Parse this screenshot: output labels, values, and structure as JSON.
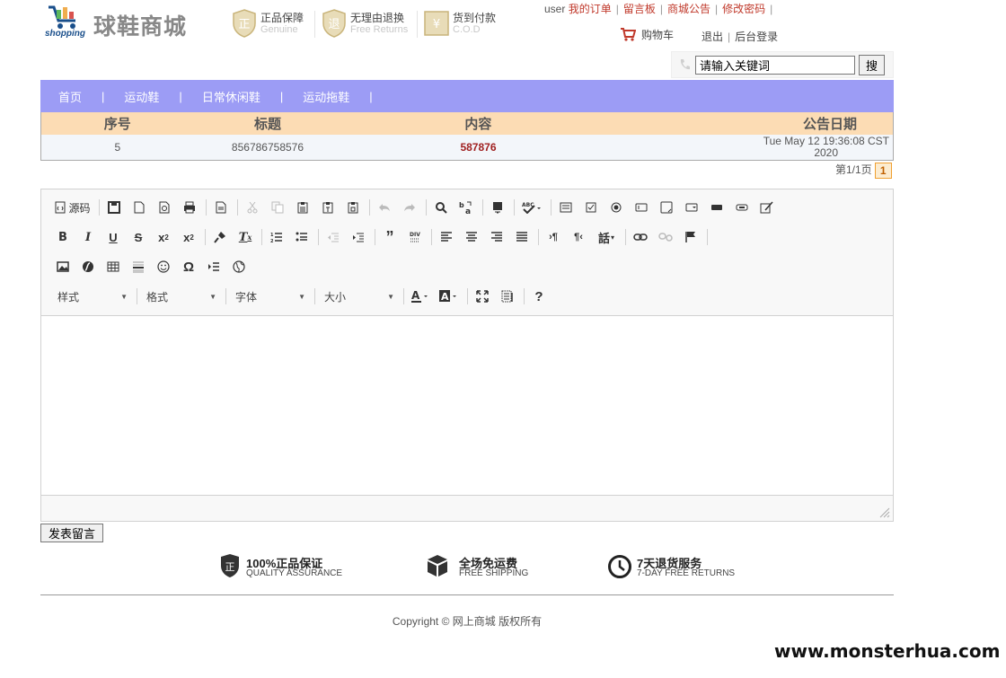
{
  "header": {
    "logo_text": "shopping",
    "site_name": "球鞋商城",
    "badges": [
      {
        "glyph": "正",
        "main": "正品保障",
        "sub": "Genuine"
      },
      {
        "glyph": "退",
        "main": "无理由退换",
        "sub": "Free Returns"
      },
      {
        "glyph": "¥",
        "main": "货到付款",
        "sub": "C.O.D"
      }
    ],
    "user": "user",
    "top_links": [
      "我的订单",
      "留言板",
      "商城公告",
      "修改密码"
    ],
    "cart_label": "购物车",
    "logout_label": "退出",
    "admin_label": "后台登录"
  },
  "search": {
    "value": "请输入关键词",
    "button_label": "搜"
  },
  "nav": {
    "items": [
      "首页",
      "运动鞋",
      "日常休闲鞋",
      "运动拖鞋"
    ]
  },
  "table": {
    "headers": [
      "序号",
      "标题",
      "内容",
      "公告日期"
    ],
    "rows": [
      {
        "id": "5",
        "title": "856786758576",
        "content": "587876",
        "date_line1": "Tue May 12 19:36:08 CST",
        "date_line2": "2020"
      }
    ]
  },
  "pager": {
    "text": "第1/1页",
    "current": "1"
  },
  "editor": {
    "source_label": "源码",
    "combos": [
      "样式",
      "格式",
      "字体",
      "大小"
    ],
    "help_label": "?"
  },
  "post_button_label": "发表留言",
  "footer": {
    "features": [
      {
        "icon": "shield-icon",
        "main": "100%正品保证",
        "sub": "QUALITY ASSURANCE"
      },
      {
        "icon": "box-icon",
        "main": "全场免运费",
        "sub": "FREE SHIPPING"
      },
      {
        "icon": "clock-icon",
        "main": "7天退货服务",
        "sub": "7-DAY FREE RETURNS"
      }
    ],
    "copyright": "Copyright © 网上商城 版权所有"
  },
  "watermark": "www.monsterhua.com"
}
